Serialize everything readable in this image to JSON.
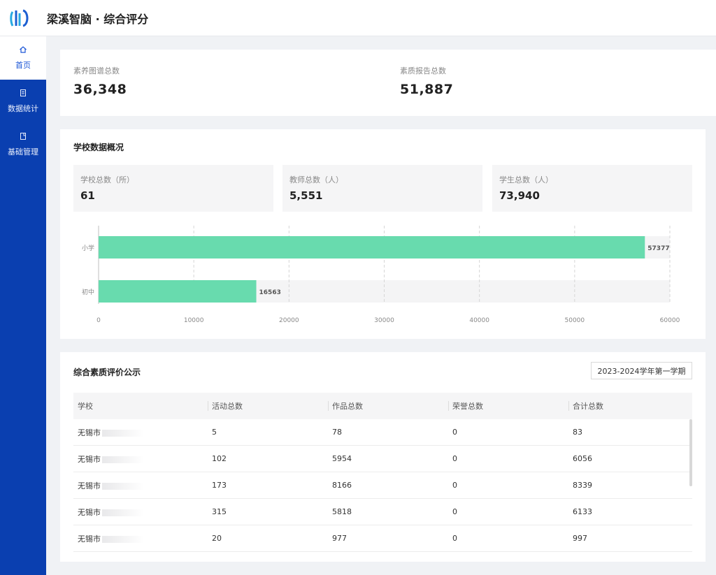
{
  "header": {
    "title": "梁溪智脑 · 综合评分",
    "logo_icon": "logo-icon"
  },
  "sidebar": {
    "items": [
      {
        "label": "首页",
        "icon": "home-icon",
        "active": true
      },
      {
        "label": "数据统计",
        "icon": "list-icon",
        "active": false
      },
      {
        "label": "基础管理",
        "icon": "document-icon",
        "active": false
      }
    ]
  },
  "stats": {
    "atlas_label": "素养图谱总数",
    "atlas_value": "36,348",
    "report_label": "素质报告总数",
    "report_value": "51,887"
  },
  "school_overview": {
    "title": "学校数据概况",
    "cards": [
      {
        "label": "学校总数（所）",
        "value": "61"
      },
      {
        "label": "教师总数（人）",
        "value": "5,551"
      },
      {
        "label": "学生总数（人）",
        "value": "73,940"
      }
    ]
  },
  "chart_data": {
    "type": "bar",
    "orientation": "horizontal",
    "categories": [
      "小学",
      "初中"
    ],
    "values": [
      57377,
      16563
    ],
    "xlim": [
      0,
      60000
    ],
    "xticks": [
      0,
      10000,
      20000,
      30000,
      40000,
      50000,
      60000
    ],
    "bar_color": "#68dbae",
    "track_color": "#f4f4f5",
    "grid": "vertical-dashed"
  },
  "evaluation": {
    "title": "综合素质评价公示",
    "term": "2023-2024学年第一学期",
    "columns": [
      "学校",
      "活动总数",
      "作品总数",
      "荣誉总数",
      "合计总数"
    ],
    "rows": [
      [
        "无锡市",
        "5",
        "78",
        "0",
        "83"
      ],
      [
        "无锡市",
        "102",
        "5954",
        "0",
        "6056"
      ],
      [
        "无锡市",
        "173",
        "8166",
        "0",
        "8339"
      ],
      [
        "无锡市",
        "315",
        "5818",
        "0",
        "6133"
      ],
      [
        "无锡市",
        "20",
        "977",
        "0",
        "997"
      ]
    ]
  },
  "colors": {
    "sidebar": "#0a3fb0",
    "accent": "#1a55d6",
    "bar": "#68dbae"
  }
}
